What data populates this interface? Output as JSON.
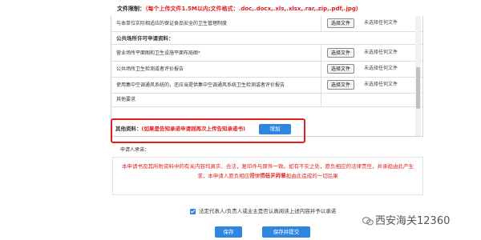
{
  "file_limit": {
    "label": "文件限制：",
    "text": "（每个上传文件1.5M以内;文件格式：.doc,.docx,.xls,.xlsx,.rar,.zip,.pdf,.jpg）"
  },
  "file_button_label": "选择文件",
  "file_status_text": "未选择任何文件",
  "rows_top": [
    {
      "label": "与本单位实际相适应的保证食品安全的卫生管理制度",
      "required": false
    }
  ],
  "section_title": "公共场所许可申请资料：",
  "rows_section": [
    {
      "label": "营业场所平面图和卫生设施平面布局图",
      "required": true,
      "has_file": true
    },
    {
      "label": "公共场所卫生检测或者评价报告",
      "required": false,
      "has_file": true
    },
    {
      "label": "使用集中空调通风系统的，还应当提供集中空调通风系统卫生检测或者评价报告",
      "required": false,
      "has_file": true
    },
    {
      "label": "其他要求",
      "required": false,
      "has_file": false
    }
  ],
  "other": {
    "label": "其他资料：",
    "note": "(如果是告知承诺申请则再次上传告知承诺书)",
    "add_button": "增加"
  },
  "applicant_label": "申请人承诺：",
  "notice": {
    "line1": "本申请书及其所附资料中的有关内容均真实、合法，复印件与原件一致。如有不实之处，愿负相应的法律责任，并承担由此产生的一切后果的要",
    "line2": "求，本申请人愿负相应法律责任，并承担由此造成的一切后果"
  },
  "agreement": {
    "checked": true,
    "text": "法定代表人/负责人或业主是否认真阅读上述内容并予以承诺"
  },
  "buttons": {
    "save": "保存",
    "save_submit": "保存并提交"
  },
  "watermark": "西安海关12360",
  "colors": {
    "accent": "#2f86e0",
    "warning": "#e02020"
  }
}
